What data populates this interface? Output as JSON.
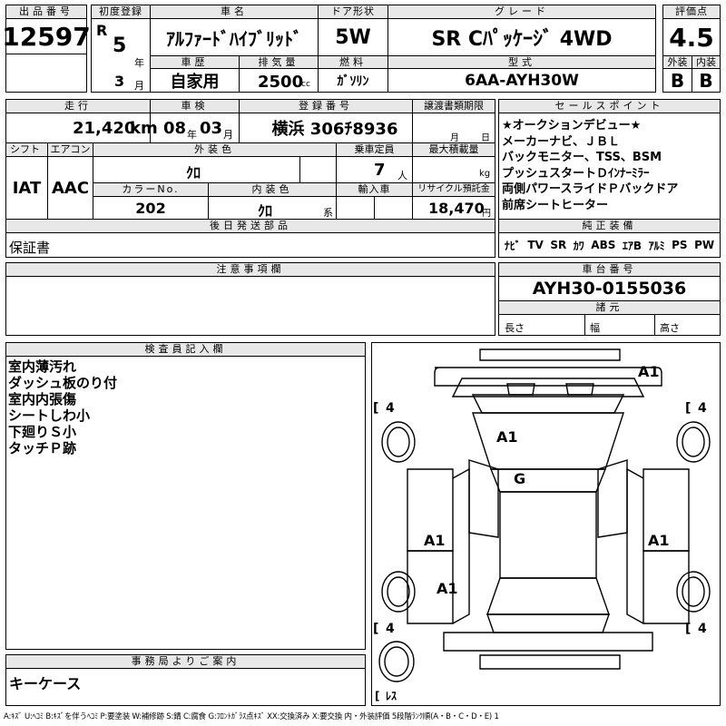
{
  "top": {
    "lot_label": "出品番号",
    "lot_number": "12597",
    "reg_label": "初度登録",
    "era": "R",
    "year": "5",
    "year_unit": "年",
    "month": "3",
    "month_unit": "月",
    "name_label": "車名",
    "name": "ｱﾙﾌｧｰﾄﾞﾊｲﾌﾞﾘｯﾄﾞ",
    "door_label": "ドア形状",
    "door": "5W",
    "grade_label": "グレード",
    "grade": "SR Cﾊﾟｯｹｰｼﾞ 4WD",
    "score_label": "評価点",
    "score": "4.5",
    "history_label": "車歴",
    "history": "自家用",
    "cc_label": "排気量",
    "cc": "2500",
    "cc_unit": "cc",
    "fuel_label": "燃料",
    "fuel": "ｶﾞｿﾘﾝ",
    "model_label": "型式",
    "model": "6AA-AYH30W",
    "ext_label": "外装",
    "int_label": "内装",
    "ext_grade": "B",
    "int_grade": "B"
  },
  "row2": {
    "mileage_label": "走行",
    "mileage": "21,420",
    "mileage_unit": "km",
    "inspection_label": "車検",
    "insp_year": "08",
    "insp_year_unit": "年",
    "insp_month": "03",
    "insp_month_unit": "月",
    "plate_label": "登録番号",
    "plate": "横浜 306ﾁ8936",
    "transfer_label": "譲渡書類期限",
    "transfer_month_unit": "月",
    "transfer_day_unit": "日",
    "shift_label": "シフト",
    "shift": "IAT",
    "ac_label": "エアコン",
    "ac": "AAC",
    "color_label": "外装色",
    "color": "ｸﾛ",
    "capacity_label": "乗車定員",
    "capacity": "7",
    "capacity_unit": "人",
    "load_label": "最大積載量",
    "load_unit": "kg",
    "color_no_label": "カラーNo.",
    "color_no": "202",
    "int_color_label": "内装色",
    "int_color": "ｸﾛ",
    "int_color_unit": "系",
    "import_label": "輸入車",
    "recycle_label": "リサイクル預託金",
    "recycle": "18,470",
    "recycle_unit": "円",
    "later_label": "後日発送部品",
    "later": "保証書"
  },
  "sales": {
    "label": "セールスポイント",
    "lines": [
      "★オークションデビュー★",
      "メーカーナビ、ＪＢＬ",
      "バックモニター、TSS、BSM",
      "プッシュスタートＤｲﾝﾅｰﾐﾗｰ",
      "両側パワースライドＰバックドア",
      "前席シートヒーター"
    ]
  },
  "equipment": {
    "label": "純正装備",
    "items": [
      "ﾅﾋﾞ",
      "TV",
      "SR",
      "ｶﾜ",
      "ABS",
      "ｴｱB",
      "ｱﾙﾐ",
      "PS",
      "PW"
    ]
  },
  "notes": {
    "label": "注意事項欄"
  },
  "chassis": {
    "label": "車台番号",
    "number": "AYH30-0155036",
    "dims_label": "諸元",
    "length_label": "長さ",
    "width_label": "幅",
    "height_label": "高さ"
  },
  "inspector": {
    "label": "検査員記入欄",
    "lines": [
      "室内薄汚れ",
      "ダッシュ板のり付",
      "室内内張傷",
      "シートしわ小",
      "下廻りＳ小",
      "タッチＰ跡"
    ]
  },
  "diagram": {
    "marks": [
      "A1",
      "A1",
      "G",
      "A1",
      "A1",
      "A1"
    ],
    "tire_fl": "4",
    "tire_fr": "4",
    "tire_rl": "4",
    "tire_rr": "4",
    "spare": "ﾚｽ"
  },
  "office": {
    "label": "事務局よりご案内",
    "text": "キーケース"
  },
  "legend": "A:ｷｽﾞ U:ﾍｺﾐ B:ｷｽﾞを伴うﾍｺﾐ P:要塗装 W:補修跡 S:錆 C:腐食 G:ﾌﾛﾝﾄｶﾞﾗｽ点ｷｽﾞ XX:交換済み X:要交換 内・外装評価 5段階ﾗﾝｸ順(A・B・C・D・E) 1"
}
